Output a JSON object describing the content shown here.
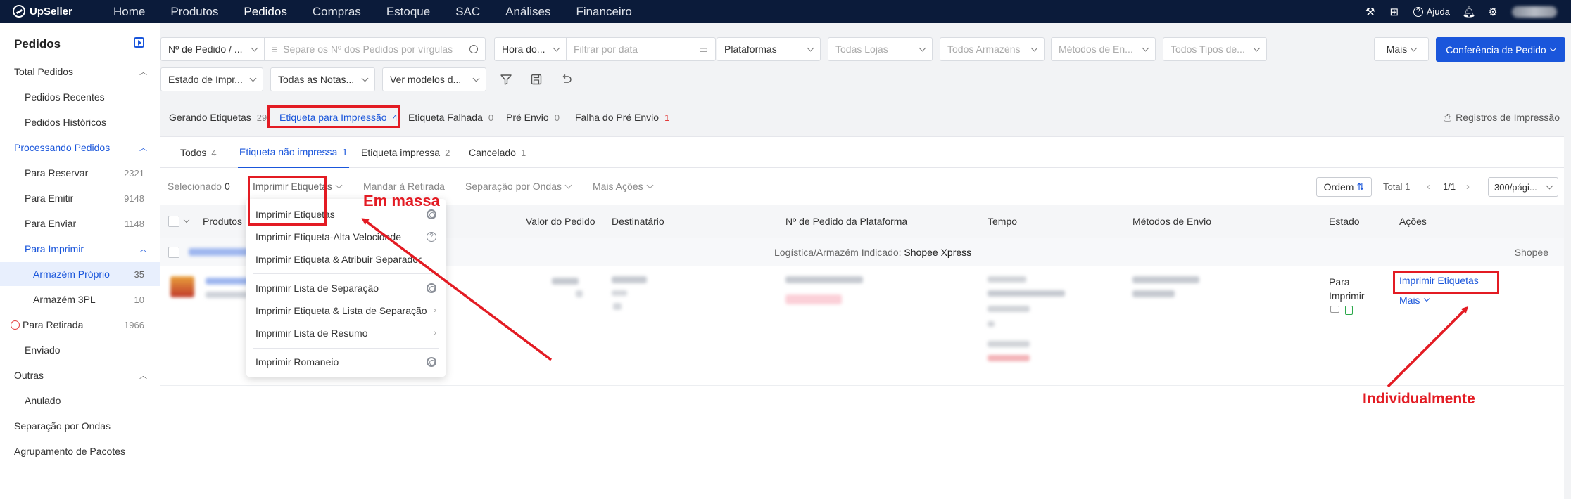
{
  "app": {
    "name": "UpSeller"
  },
  "nav": {
    "items": [
      "Home",
      "Produtos",
      "Pedidos",
      "Compras",
      "Estoque",
      "SAC",
      "Análises",
      "Financeiro"
    ],
    "help_label": "Ajuda"
  },
  "sidebar": {
    "title": "Pedidos",
    "items": [
      {
        "label": "Total Pedidos",
        "count": "",
        "level": 0
      },
      {
        "label": "Pedidos Recentes",
        "count": "",
        "level": 1
      },
      {
        "label": "Pedidos Históricos",
        "count": "",
        "level": 1
      },
      {
        "label": "Processando Pedidos",
        "count": "",
        "level": 0
      },
      {
        "label": "Para Reservar",
        "count": "2321",
        "level": 1
      },
      {
        "label": "Para Emitir",
        "count": "9148",
        "level": 1
      },
      {
        "label": "Para Enviar",
        "count": "1148",
        "level": 1
      },
      {
        "label": "Para Imprimir",
        "count": "",
        "level": 1
      },
      {
        "label": "Armazém Próprio",
        "count": "35",
        "level": 2
      },
      {
        "label": "Armazém 3PL",
        "count": "10",
        "level": 2
      },
      {
        "label": "Para Retirada",
        "count": "1966",
        "level": 1
      },
      {
        "label": "Enviado",
        "count": "",
        "level": 1
      },
      {
        "label": "Outras",
        "count": "",
        "level": 0
      },
      {
        "label": "Anulado",
        "count": "",
        "level": 1
      },
      {
        "label": "Separação por Ondas",
        "count": "",
        "level": 0
      },
      {
        "label": "Agrupamento de Pacotes",
        "count": "",
        "level": 0
      }
    ]
  },
  "filters": {
    "order_type": "Nº de Pedido / ...",
    "search_placeholder": "Separe os Nº dos Pedidos por vírgulas",
    "time_type": "Hora do...",
    "date_placeholder": "Filtrar por data",
    "platforms": "Plataformas",
    "stores": "Todas Lojas",
    "warehouses": "Todos Armazéns",
    "shipping_methods": "Métodos de En...",
    "types": "Todos Tipos de...",
    "more": "Mais",
    "print_status": "Estado de Impr...",
    "invoices": "Todas as Notas...",
    "models": "Ver modelos d...",
    "conference_button": "Conferência de Pedido"
  },
  "status_tabs": [
    {
      "label": "Gerando Etiquetas",
      "count": "29"
    },
    {
      "label": "Etiqueta para Impressão",
      "count": "4"
    },
    {
      "label": "Etiqueta Falhada",
      "count": "0"
    },
    {
      "label": "Pré Envio",
      "count": "0"
    },
    {
      "label": "Falha do Pré Envio",
      "count": "1"
    }
  ],
  "print_records": "Registros de Impressão",
  "sub_tabs": [
    {
      "label": "Todos",
      "count": "4"
    },
    {
      "label": "Etiqueta não impressa",
      "count": "1"
    },
    {
      "label": "Etiqueta impressa",
      "count": "2"
    },
    {
      "label": "Cancelado",
      "count": "1"
    }
  ],
  "toolbar": {
    "selected_label": "Selecionado",
    "selected_count": "0",
    "print_labels": "Imprimir Etiquetas",
    "send_pickup": "Mandar à Retirada",
    "wave_picking": "Separação por Ondas",
    "more_actions": "Mais Ações",
    "sort": "Ordem",
    "total": "Total 1",
    "page": "1/1",
    "per_page": "300/pági..."
  },
  "table": {
    "headers": [
      "Produtos",
      "Valor do Pedido",
      "Destinatário",
      "Nº de Pedido da Plataforma",
      "Tempo",
      "Métodos de Envio",
      "Estado",
      "Ações"
    ],
    "group_label": "Logística/Armazém Indicado:",
    "group_value": "Shopee Xpress",
    "group_platform": "Shopee",
    "row": {
      "status": "Para Imprimir",
      "action_print": "Imprimir Etiquetas",
      "action_more": "Mais"
    }
  },
  "dropdown": {
    "items": [
      "Imprimir Etiquetas",
      "Imprimir Etiqueta-Alta Velocidade",
      "Imprimir Etiqueta & Atribuir Separador",
      "Imprimir Lista de Separação",
      "Imprimir Etiqueta & Lista de Separação",
      "Imprimir Lista de Resumo",
      "Imprimir Romaneio"
    ]
  },
  "annotations": {
    "bulk": "Em massa",
    "individual": "Individualmente"
  },
  "colors": {
    "primary": "#1a56db",
    "nav_bg": "#0b1b3a",
    "annotation": "#e31b23"
  }
}
